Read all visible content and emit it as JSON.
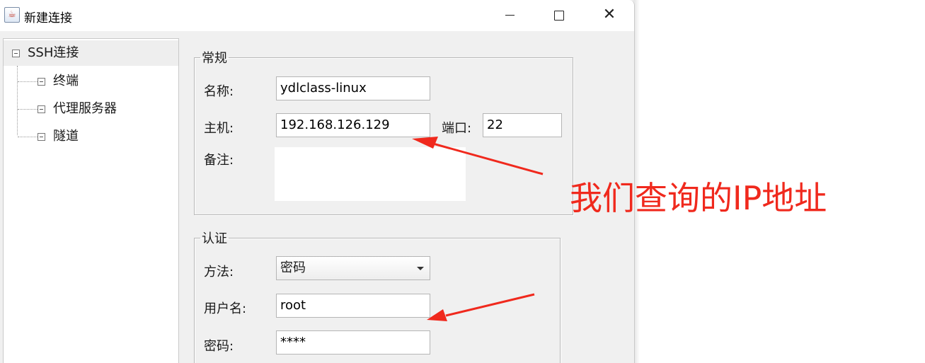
{
  "window": {
    "title": "新建连接",
    "icon": "java-cup-icon"
  },
  "tree": {
    "root": "SSH连接",
    "children": [
      "终端",
      "代理服务器",
      "隧道"
    ]
  },
  "general": {
    "legend": "常规",
    "name_label": "名称:",
    "name_value": "ydlclass-linux",
    "host_label": "主机:",
    "host_value": "192.168.126.129",
    "port_label": "端口:",
    "port_value": "22",
    "notes_label": "备注:",
    "notes_value": ""
  },
  "auth": {
    "legend": "认证",
    "method_label": "方法:",
    "method_value": "密码",
    "username_label": "用户名:",
    "username_value": "root",
    "password_label": "密码:",
    "password_value": "****"
  },
  "annotation": {
    "text": "我们查询的IP地址",
    "color": "#f0291d"
  }
}
